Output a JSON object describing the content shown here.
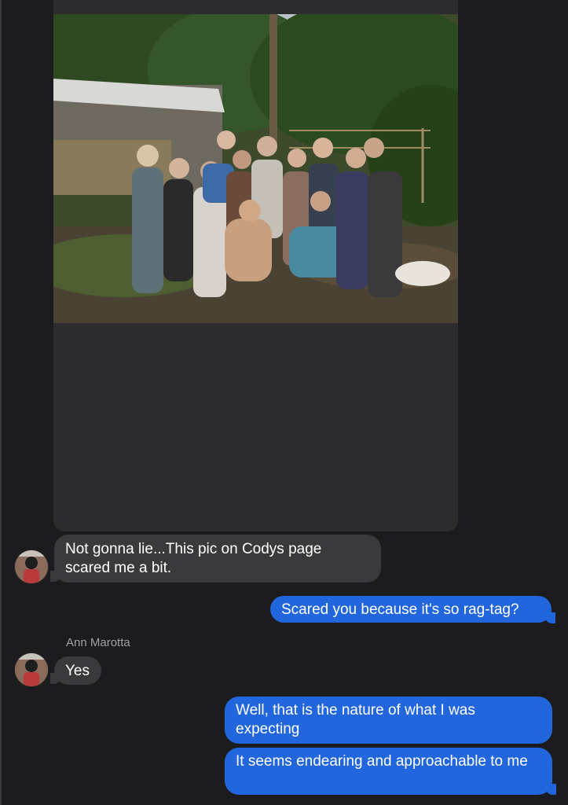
{
  "conversation": {
    "messages": [
      {
        "direction": "incoming",
        "text": "Not gonna lie...This pic on Codys page scared me a bit."
      },
      {
        "direction": "outgoing",
        "text": "Scared you because it's so rag-tag?"
      },
      {
        "direction": "incoming",
        "sender": "Ann Marotta",
        "text": "Yes"
      },
      {
        "direction": "outgoing",
        "text": "Well, that is the nature of what I was expecting"
      },
      {
        "direction": "outgoing",
        "text": "It seems endearing and approachable to me"
      }
    ]
  },
  "attachment": {
    "type": "photo",
    "icon": "group-photo-image"
  },
  "colors": {
    "background": "#1c1c1e",
    "incoming_bubble": "#3a3a3c",
    "outgoing_bubble": "#2266dd",
    "sender_name": "#a0a0a5"
  }
}
